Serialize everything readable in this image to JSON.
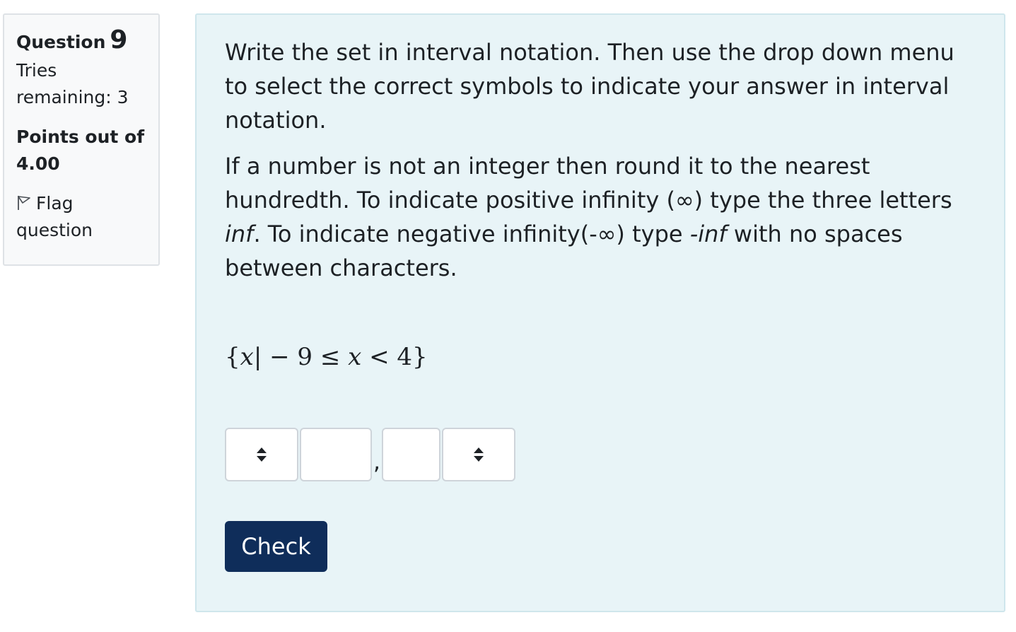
{
  "info": {
    "question_label": "Question",
    "question_number": "9",
    "state": "Tries remaining: 3",
    "grade": "Points out of 4.00",
    "flag_label": "Flag question"
  },
  "question": {
    "paragraph1": "Write the set in interval notation. Then use the drop down menu to select the correct symbols to indicate your answer in interval notation.",
    "paragraph2": {
      "part1": "If a number is not an integer then round it to the nearest hundredth. To indicate positive infinity (∞) type the three letters ",
      "em1": "inf",
      "part2": ". To indicate negative infinity(-∞) type ",
      "em2": "-inf",
      "part3": " with no spaces between characters."
    },
    "math": {
      "open": "{",
      "var1": "x",
      "mid": "| − 9 ≤ ",
      "var2": "x",
      "rest": " < 4}"
    }
  },
  "answer": {
    "left_bracket_value": "",
    "lower_bound_value": "",
    "separator": ",",
    "upper_bound_value": "",
    "right_bracket_value": ""
  },
  "check_button": {
    "label": "Check",
    "color": "#0f2d5a"
  },
  "icons": {
    "flag": "flag-icon",
    "select": "sort-arrows-icon"
  },
  "colors": {
    "panel_background": "#e8f4f7",
    "info_background": "#f8f9fa"
  }
}
